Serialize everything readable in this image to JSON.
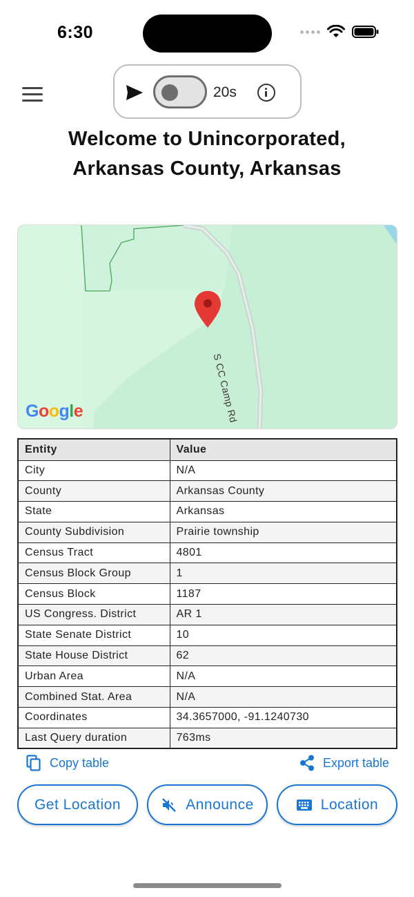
{
  "status_bar": {
    "time": "6:30"
  },
  "control": {
    "interval": "20s",
    "toggle_on": false,
    "icons": [
      "send-icon",
      "info-icon"
    ]
  },
  "title": "Welcome to Unincorporated, Arkansas County, Arkansas",
  "map": {
    "road_label": "S CC Camp Rd",
    "attribution": "Google",
    "pin_color": "#e53935"
  },
  "table": {
    "headers": [
      "Entity",
      "Value"
    ],
    "rows": [
      [
        "City",
        "N/A"
      ],
      [
        "County",
        "Arkansas County"
      ],
      [
        "State",
        "Arkansas"
      ],
      [
        "County Subdivision",
        "Prairie township"
      ],
      [
        "Census Tract",
        "4801"
      ],
      [
        "Census Block Group",
        "1"
      ],
      [
        "Census Block",
        "1187"
      ],
      [
        "US Congress. District",
        "AR 1"
      ],
      [
        "State Senate District",
        "10"
      ],
      [
        "State House District",
        "62"
      ],
      [
        "Urban Area",
        "N/A"
      ],
      [
        "Combined Stat. Area",
        "N/A"
      ],
      [
        "Coordinates",
        "34.3657000, -91.1240730"
      ],
      [
        "Last Query duration",
        "763ms"
      ]
    ]
  },
  "actions": {
    "copy_label": "Copy table",
    "export_label": "Export table",
    "get_location_label": "Get Location",
    "announce_label": "Announce",
    "location_label": "Location"
  },
  "colors": {
    "accent": "#1976d2",
    "map_bg": "#c6efd6"
  }
}
